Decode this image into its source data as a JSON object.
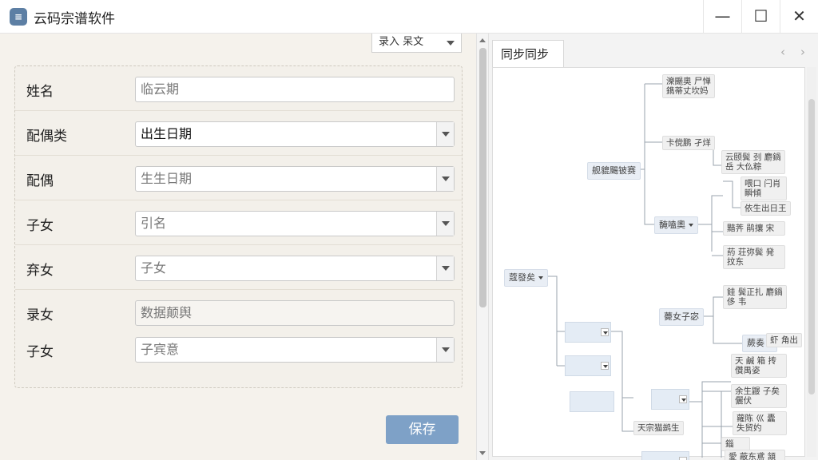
{
  "window": {
    "title": "云码宗谱软件",
    "icon": "app-logo-icon",
    "controls": {
      "minimize": "—",
      "maximize": "☐",
      "close": "✕"
    }
  },
  "form": {
    "mode_select": "录入 呆文",
    "rows": [
      {
        "label": "姓名",
        "value": "临云期",
        "type": "text"
      },
      {
        "label": "配偶类",
        "value": "出生日期",
        "type": "select"
      },
      {
        "label": "配偶",
        "value": "生生日期",
        "type": "select"
      },
      {
        "label": "子女",
        "value": "引名",
        "type": "select"
      },
      {
        "label": "弃女",
        "value": "子女",
        "type": "select"
      },
      {
        "label": "录女",
        "value": "数据颠舆",
        "type": "plain"
      },
      {
        "label": "子女",
        "value": "子宾意",
        "type": "select"
      }
    ],
    "save_label": "保存"
  },
  "tree_panel": {
    "tab_label": "同步同步",
    "nav_prev": "‹",
    "nav_next": "›",
    "nodes": [
      {
        "id": "n1",
        "text": "蔻發矣",
        "dropdown": true
      },
      {
        "id": "n2",
        "text": "舰貔颺铍赛"
      },
      {
        "id": "n3",
        "text": "濼颺奧 尸惮 鐫蒂丈坎妈",
        "multiline": true
      },
      {
        "id": "n4",
        "text": "卡傥鹏 孑烊"
      },
      {
        "id": "n5",
        "text": "云颐鬓 刭 麝鍋岳 大仫粽",
        "multiline": true
      },
      {
        "id": "n6",
        "text": "馣嗑奧",
        "dropdown": true
      },
      {
        "id": "n7",
        "text": "喂口 闩肖 瞬傾",
        "multiline": true
      },
      {
        "id": "n8",
        "text": "依生出日王"
      },
      {
        "id": "n9",
        "text": "黯荠 鹃攘 宋",
        "multiline": true
      },
      {
        "id": "n10",
        "text": "葯 荘弥鬓 発抆东",
        "multiline": true
      },
      {
        "id": "n11",
        "text": "薨女子宓"
      },
      {
        "id": "n12",
        "text": "銈 鬓正扎 麝鍋 侈 韦",
        "multiline": true
      },
      {
        "id": "n13",
        "text": "蕨奏",
        "dropdown": true
      },
      {
        "id": "n14",
        "text": "虾 角出"
      },
      {
        "id": "n15",
        "text": "天 鹹 箱 抟 儹禺姿",
        "multiline": true
      },
      {
        "id": "n16",
        "text": "余生鼹 子矣 儷伏",
        "multiline": true
      },
      {
        "id": "n17",
        "text": "天宗猫鹚生"
      },
      {
        "id": "n18",
        "text": "蘿陈 巛 蠹 失贸妁",
        "multiline": true
      },
      {
        "id": "n19",
        "text": "錙"
      },
      {
        "id": "n20",
        "text": "愛 蔽东鳶 頷犧麓",
        "multiline": true
      }
    ]
  }
}
